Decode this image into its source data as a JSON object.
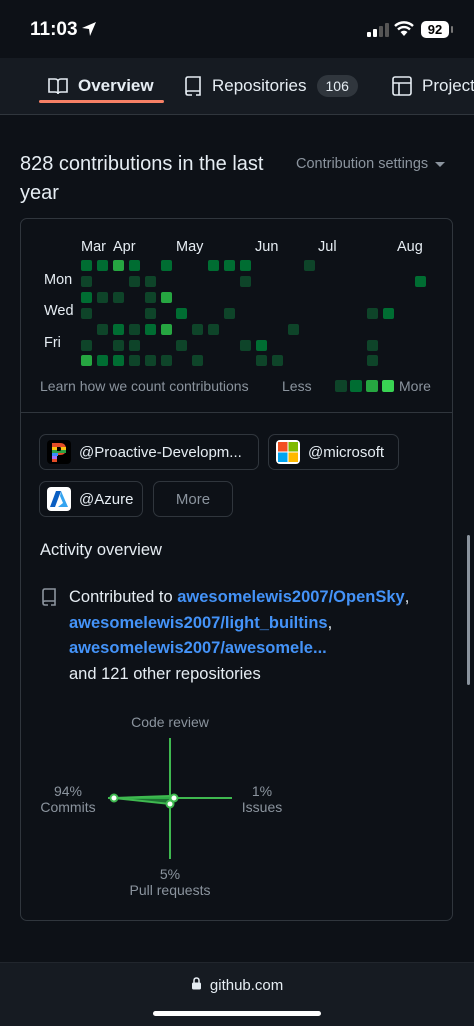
{
  "status": {
    "time": "11:03",
    "battery": "92"
  },
  "tabs": [
    {
      "label": "Overview"
    },
    {
      "label": "Repositories",
      "count": "106"
    },
    {
      "label": "Projects"
    }
  ],
  "contributions": {
    "title": "828 contributions in the last year",
    "settings_label": "Contribution settings",
    "months": [
      "Mar",
      "Apr",
      "May",
      "Jun",
      "Jul",
      "Aug"
    ],
    "days": [
      "Mon",
      "Wed",
      "Fri"
    ],
    "learn_label": "Learn how we count contributions",
    "less_label": "Less",
    "more_label": "More"
  },
  "organizations": [
    {
      "name": "@Proactive-Developm...",
      "icon": "proactive-logo"
    },
    {
      "name": "@microsoft",
      "icon": "microsoft-logo"
    },
    {
      "name": "@Azure",
      "icon": "azure-logo"
    }
  ],
  "more_button": "More",
  "activity": {
    "title": "Activity overview",
    "prefix": "Contributed to",
    "repos": [
      "awesomelewis2007/OpenSky",
      "awesomelewis2007/light_builtins",
      "awesomelewis2007/awesomele..."
    ],
    "suffix": "and 121 other repositories",
    "code_review_label": "Code review",
    "commits_pct": "94%",
    "commits_label": "Commits",
    "issues_pct": "1%",
    "issues_label": "Issues",
    "prs_pct": "5%",
    "prs_label": "Pull requests"
  },
  "browser": {
    "url": "github.com"
  },
  "colors": {
    "accent": "#f78166",
    "link": "#4493f8",
    "green": "#3fb950"
  }
}
